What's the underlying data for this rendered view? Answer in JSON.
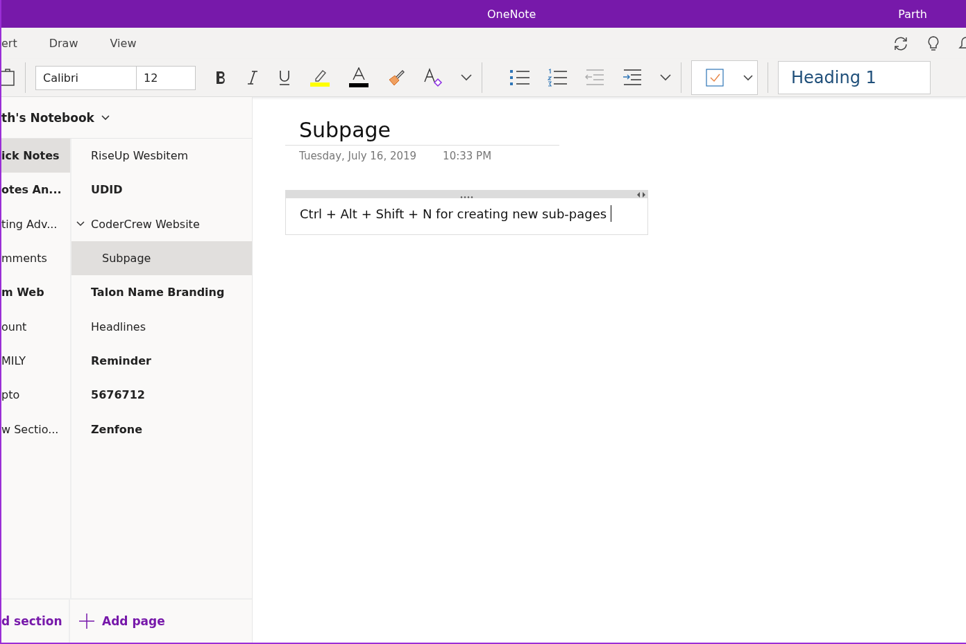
{
  "window": {
    "title": "OneNote",
    "user": "Parth"
  },
  "ribbon_tabs": [
    {
      "label": "ert",
      "selected": false
    },
    {
      "label": "Draw",
      "selected": false
    },
    {
      "label": "View",
      "selected": false
    }
  ],
  "toolbar": {
    "font": "Calibri",
    "size": "12",
    "style": "Heading 1"
  },
  "notebook": {
    "name": "th's Notebook"
  },
  "sections": [
    {
      "label": "ick Notes",
      "selected": true,
      "unread": true
    },
    {
      "label": "otes An...",
      "selected": false,
      "unread": true
    },
    {
      "label": "ting Adv...",
      "selected": false,
      "unread": false
    },
    {
      "label": "mments",
      "selected": false,
      "unread": false
    },
    {
      "label": "m Web",
      "selected": false,
      "unread": true
    },
    {
      "label": "ount",
      "selected": false,
      "unread": false
    },
    {
      "label": "MILY",
      "selected": false,
      "unread": false
    },
    {
      "label": "pto",
      "selected": false,
      "unread": false
    },
    {
      "label": "w Sectio...",
      "selected": false,
      "unread": false
    }
  ],
  "pages": [
    {
      "label": "RiseUp Wesbitem",
      "selected": false,
      "unread": false
    },
    {
      "label": "UDID",
      "selected": false,
      "unread": true
    },
    {
      "label": "CoderCrew Website",
      "selected": false,
      "unread": false,
      "expanded": true,
      "children": [
        {
          "label": "Subpage",
          "selected": true,
          "unread": false
        }
      ]
    },
    {
      "label": "Talon Name Branding",
      "selected": false,
      "unread": true
    },
    {
      "label": "Headlines",
      "selected": false,
      "unread": false
    },
    {
      "label": "Reminder",
      "selected": false,
      "unread": true
    },
    {
      "label": "5676712",
      "selected": false,
      "unread": true
    },
    {
      "label": "Zenfone",
      "selected": false,
      "unread": true
    }
  ],
  "add_section": "d section",
  "add_page": "Add page",
  "page": {
    "title": "Subpage",
    "date": "Tuesday, July 16, 2019",
    "time": "10:33 PM",
    "note": "Ctrl + Alt + Shift + N for creating new sub-pages"
  }
}
